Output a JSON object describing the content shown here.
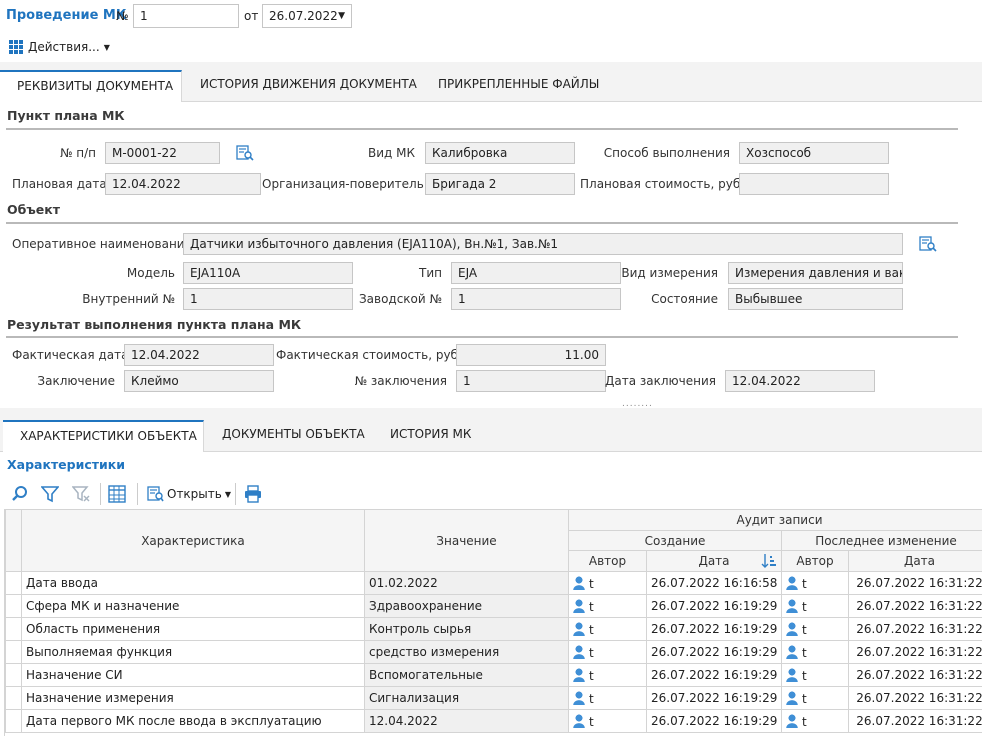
{
  "header": {
    "title": "Проведение МК",
    "number_label": "№",
    "number_value": "1",
    "date_label": "от",
    "date_value": "26.07.2022"
  },
  "toolbar": {
    "actions_label": "Действия..."
  },
  "tabs": [
    {
      "label": "РЕКВИЗИТЫ ДОКУМЕНТА"
    },
    {
      "label": "ИСТОРИЯ ДВИЖЕНИЯ ДОКУМЕНТА"
    },
    {
      "label": "ПРИКРЕПЛЕННЫЕ ФАЙЛЫ"
    }
  ],
  "plan": {
    "section_title": "Пункт плана МК",
    "num_label": "№ п/п",
    "num_value": "M-0001-22",
    "type_label": "Вид МК",
    "type_value": "Калибровка",
    "method_label": "Способ выполнения",
    "method_value": "Хозспособ",
    "date_label": "Плановая дата",
    "date_value": "12.04.2022",
    "org_label": "Организация-поверитель",
    "org_value": "Бригада 2",
    "cost_label": "Плановая стоимость, руб.",
    "cost_value": ""
  },
  "object": {
    "section_title": "Объект",
    "name_label": "Оперативное наименование",
    "name_value": "Датчики избыточного давления (EJA110A), Вн.№1, Зав.№1",
    "model_label": "Модель",
    "model_value": "EJA110A",
    "type_label": "Тип",
    "type_value": "EJA",
    "meas_label": "Вид измерения",
    "meas_value": "Измерения давления и вакуума",
    "internal_label": "Внутренний №",
    "internal_value": "1",
    "serial_label": "Заводской №",
    "serial_value": "1",
    "state_label": "Состояние",
    "state_value": "Выбывшее"
  },
  "result": {
    "section_title": "Результат выполнения пункта плана МК",
    "fact_date_label": "Фактическая дата",
    "fact_date_value": "12.04.2022",
    "fact_cost_label": "Фактическая стоимость, руб.",
    "fact_cost_value": "11.00",
    "conclusion_label": "Заключение",
    "conclusion_value": "Клеймо",
    "conc_num_label": "№ заключения",
    "conc_num_value": "1",
    "conc_date_label": "Дата заключения",
    "conc_date_value": "12.04.2022"
  },
  "bottom_tabs": [
    {
      "label": "ХАРАКТЕРИСТИКИ ОБЪЕКТА"
    },
    {
      "label": "ДОКУМЕНТЫ ОБЪЕКТА"
    },
    {
      "label": "ИСТОРИЯ МК"
    }
  ],
  "characteristics": {
    "title": "Характеристики",
    "open_label": "Открыть"
  },
  "table": {
    "col_characteristic": "Характеристика",
    "col_value": "Значение",
    "col_audit": "Аудит записи",
    "col_created": "Создание",
    "col_modified": "Последнее изменение",
    "col_author": "Автор",
    "col_date": "Дата",
    "rows": [
      {
        "name": "Дата ввода",
        "value": "01.02.2022",
        "author": "t",
        "created": "26.07.2022 16:16:58",
        "mod_author": "t",
        "modified": "26.07.2022 16:31:22"
      },
      {
        "name": "Сфера МК и назначение",
        "value": "Здравоохранение",
        "author": "t",
        "created": "26.07.2022 16:19:29",
        "mod_author": "t",
        "modified": "26.07.2022 16:31:22"
      },
      {
        "name": "Область применения",
        "value": "Контроль сырья",
        "author": "t",
        "created": "26.07.2022 16:19:29",
        "mod_author": "t",
        "modified": "26.07.2022 16:31:22"
      },
      {
        "name": "Выполняемая функция",
        "value": "средство измерения",
        "author": "t",
        "created": "26.07.2022 16:19:29",
        "mod_author": "t",
        "modified": "26.07.2022 16:31:22"
      },
      {
        "name": "Назначение СИ",
        "value": "Вспомогательные",
        "author": "t",
        "created": "26.07.2022 16:19:29",
        "mod_author": "t",
        "modified": "26.07.2022 16:31:22"
      },
      {
        "name": "Назначение измерения",
        "value": "Сигнализация",
        "author": "t",
        "created": "26.07.2022 16:19:29",
        "mod_author": "t",
        "modified": "26.07.2022 16:31:22"
      },
      {
        "name": "Дата первого МК после ввода в эксплуатацию",
        "value": "12.04.2022",
        "author": "t",
        "created": "26.07.2022 16:19:29",
        "mod_author": "t",
        "modified": "26.07.2022 16:31:22"
      }
    ]
  },
  "icons": {
    "actions": "grid-dots-icon",
    "lookup": "list-search-icon",
    "search": "magnifier-icon",
    "filter": "filter-icon",
    "filter_clear": "filter-clear-icon",
    "columns": "grid-columns-icon",
    "open": "open-document-icon",
    "print": "printer-icon",
    "user": "user-icon",
    "sort": "sort-ascending-icon"
  },
  "colors": {
    "accent": "#1a6fb5",
    "title_blue": "#1f74bf",
    "icon_blue": "#2f7fc6"
  }
}
